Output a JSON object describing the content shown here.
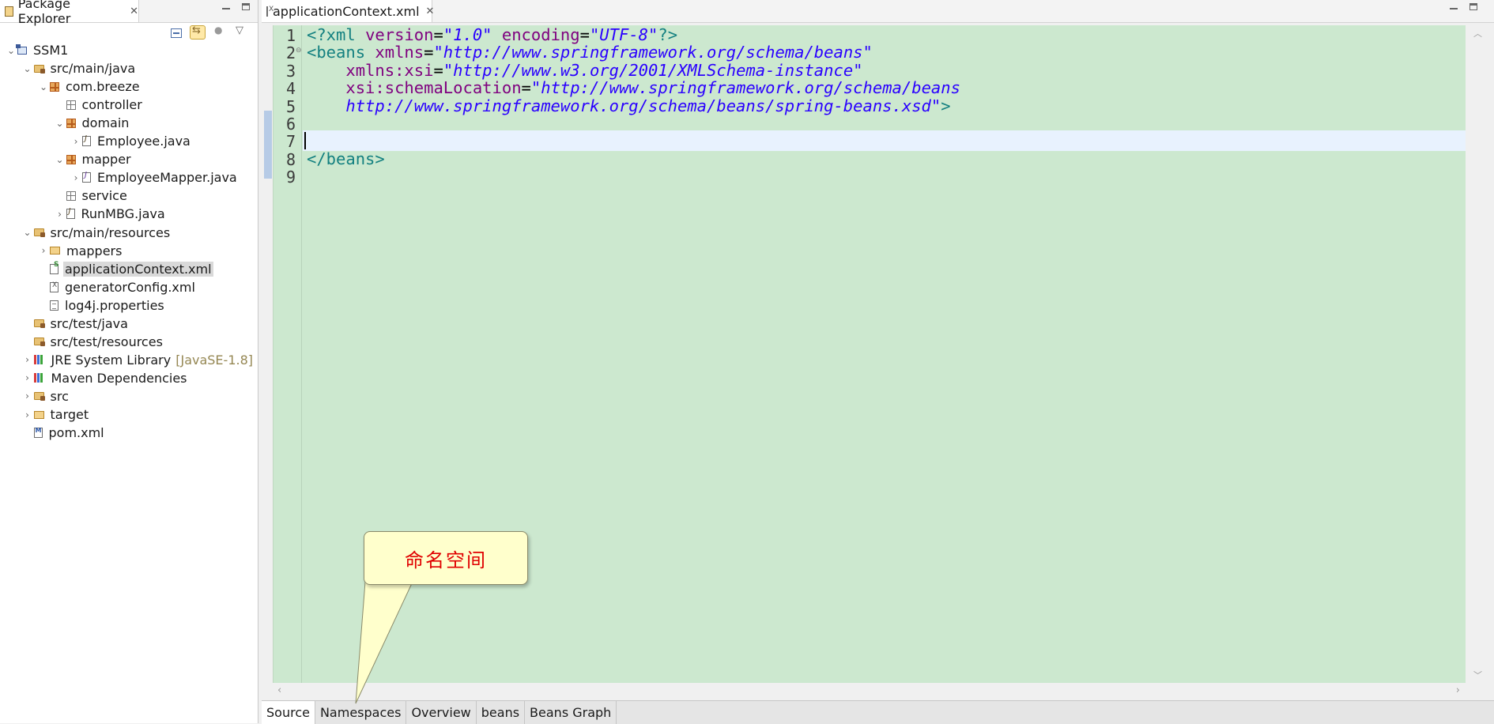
{
  "explorer": {
    "tab_label": "Package Explorer",
    "tree": [
      {
        "label": "SSM1",
        "icon": "project-icon",
        "level": 0,
        "expanded": true
      },
      {
        "label": "src/main/java",
        "icon": "source-folder-icon",
        "level": 1,
        "expanded": true
      },
      {
        "label": "com.breeze",
        "icon": "package-icon",
        "level": 2,
        "expanded": true
      },
      {
        "label": "controller",
        "icon": "empty-package-icon",
        "level": 3
      },
      {
        "label": "domain",
        "icon": "package-icon",
        "level": 3,
        "expanded": true
      },
      {
        "label": "Employee.java",
        "icon": "java-file-icon",
        "level": 4,
        "expandable": true
      },
      {
        "label": "mapper",
        "icon": "package-icon",
        "level": 3,
        "expanded": true
      },
      {
        "label": "EmployeeMapper.java",
        "icon": "interface-file-icon",
        "level": 4,
        "expandable": true
      },
      {
        "label": "service",
        "icon": "empty-package-icon",
        "level": 3
      },
      {
        "label": "RunMBG.java",
        "icon": "java-file-icon",
        "level": 3,
        "expandable": true
      },
      {
        "label": "src/main/resources",
        "icon": "source-folder-icon",
        "level": 1,
        "expanded": true
      },
      {
        "label": "mappers",
        "icon": "folder-icon",
        "level": 2,
        "expandable": true
      },
      {
        "label": "applicationContext.xml",
        "icon": "spring-xml-icon",
        "level": 2,
        "selected": true
      },
      {
        "label": "generatorConfig.xml",
        "icon": "xml-file-icon",
        "level": 2
      },
      {
        "label": "log4j.properties",
        "icon": "properties-file-icon",
        "level": 2
      },
      {
        "label": "src/test/java",
        "icon": "source-folder-icon",
        "level": 1
      },
      {
        "label": "src/test/resources",
        "icon": "source-folder-icon",
        "level": 1
      },
      {
        "label": "JRE System Library",
        "decoration": "[JavaSE-1.8]",
        "icon": "library-icon",
        "level": 1,
        "expandable": true
      },
      {
        "label": "Maven Dependencies",
        "icon": "library-icon",
        "level": 1,
        "expandable": true
      },
      {
        "label": "src",
        "icon": "source-folder-icon",
        "level": 1,
        "expandable": true
      },
      {
        "label": "target",
        "icon": "folder-icon",
        "level": 1,
        "expandable": true
      },
      {
        "label": "pom.xml",
        "icon": "pom-file-icon",
        "level": 1
      }
    ]
  },
  "editor": {
    "tab_label": "applicationContext.xml",
    "line_numbers": [
      "1",
      "2",
      "3",
      "4",
      "5",
      "6",
      "7",
      "8",
      "9"
    ],
    "lines": [
      [
        {
          "t": "tag",
          "s": "<?xml "
        },
        {
          "t": "attr",
          "s": "version"
        },
        {
          "t": "eq",
          "s": "="
        },
        {
          "t": "val",
          "s": "\"1.0\""
        },
        {
          "t": "eq",
          "s": " "
        },
        {
          "t": "attr",
          "s": "encoding"
        },
        {
          "t": "eq",
          "s": "="
        },
        {
          "t": "val",
          "s": "\"UTF-8\""
        },
        {
          "t": "tag",
          "s": "?>"
        }
      ],
      [
        {
          "t": "tag",
          "s": "<beans "
        },
        {
          "t": "attr",
          "s": "xmlns"
        },
        {
          "t": "eq",
          "s": "="
        },
        {
          "t": "val",
          "s": "\"http://www.springframework.org/schema/beans\""
        }
      ],
      [
        {
          "t": "eq",
          "s": "    "
        },
        {
          "t": "attr",
          "s": "xmlns:xsi"
        },
        {
          "t": "eq",
          "s": "="
        },
        {
          "t": "val",
          "s": "\"http://www.w3.org/2001/XMLSchema-instance\""
        }
      ],
      [
        {
          "t": "eq",
          "s": "    "
        },
        {
          "t": "attr",
          "s": "xsi:schemaLocation"
        },
        {
          "t": "eq",
          "s": "="
        },
        {
          "t": "val",
          "s": "\"http://www.springframework.org/schema/beans"
        }
      ],
      [
        {
          "t": "val",
          "s": "    http://www.springframework.org/schema/beans/spring-beans.xsd\""
        },
        {
          "t": "tag",
          "s": ">"
        }
      ],
      [],
      [],
      [
        {
          "t": "tag",
          "s": "</beans>"
        }
      ],
      []
    ],
    "bottom_tabs": [
      "Source",
      "Namespaces",
      "Overview",
      "beans",
      "Beans Graph"
    ],
    "active_bottom_tab": "Source"
  },
  "callout": {
    "text": "命名空间"
  },
  "colors": {
    "editor_background": "#cce8cf",
    "tag": "#138080",
    "attribute": "#7f007f",
    "value": "#2a00ff",
    "callout_text": "#e00000",
    "callout_fill": "#ffffcc"
  }
}
